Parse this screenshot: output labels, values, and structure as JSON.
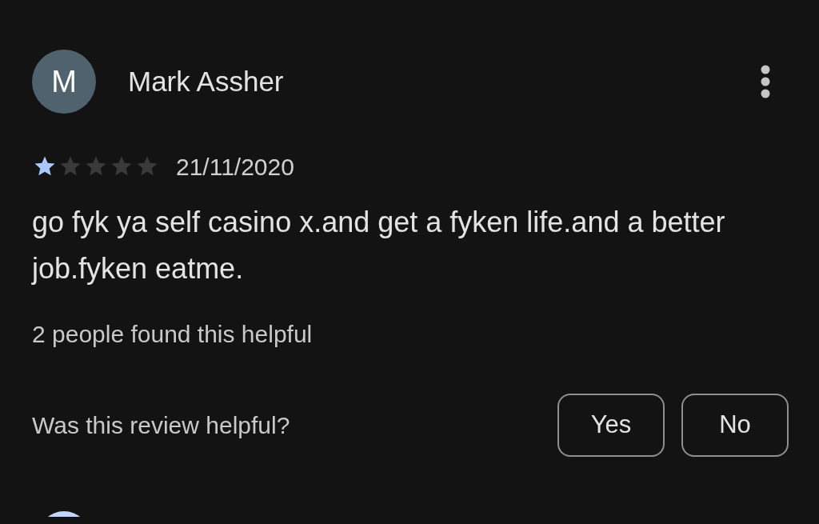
{
  "review": {
    "avatar_letter": "M",
    "author": "Mark Assher",
    "stars": 1,
    "date": "21/11/2020",
    "text": "go fyk ya self casino x.and get a fyken life.and a better job.fyken eatme.",
    "helpful_count": "2 people found this helpful",
    "question": "Was this review helpful?",
    "buttons": [
      "Yes",
      "No"
    ]
  }
}
